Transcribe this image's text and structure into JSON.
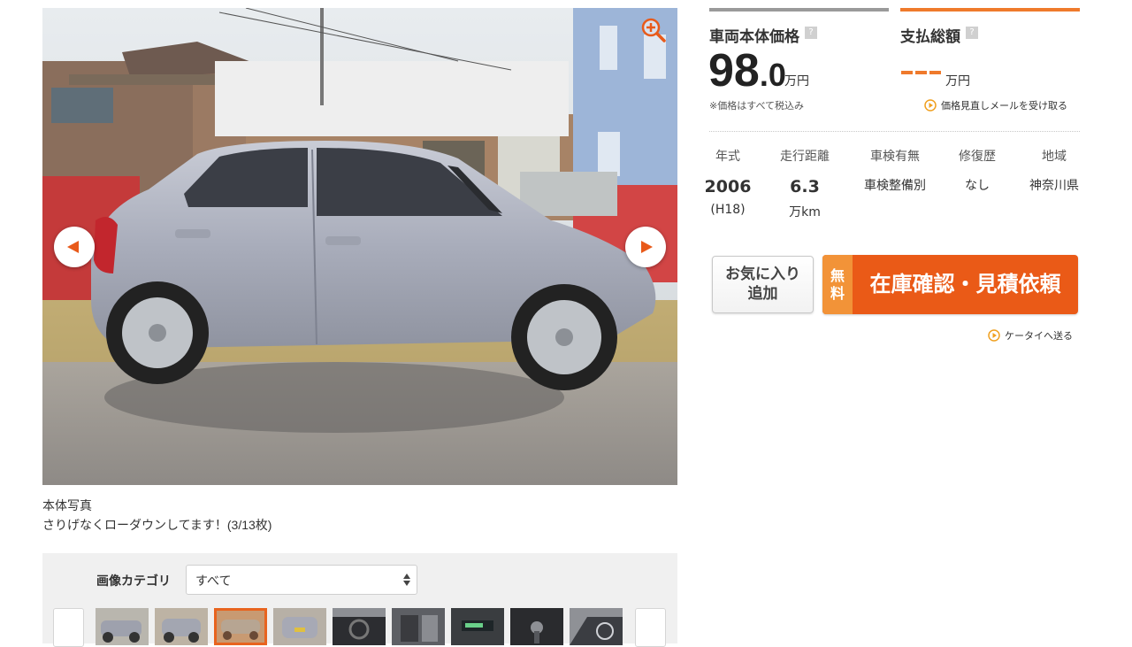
{
  "photo": {
    "caption_title": "本体写真",
    "caption_text": "さりげなくローダウンしてます！(3/13枚)"
  },
  "category": {
    "label": "画像カテゴリ",
    "selected": "すべて"
  },
  "thumbnails": {
    "count": 9,
    "active_index": 2
  },
  "price": {
    "vehicle_label": "車両本体価格",
    "vehicle_int": "98",
    "vehicle_dec": ".0",
    "unit": "万円",
    "tax_note": "※価格はすべて税込み",
    "total_label": "支払総額",
    "total_unit": "万円",
    "help": "?",
    "review_mail": "価格見直しメールを受け取る"
  },
  "specs": {
    "headers": [
      "年式",
      "走行距離",
      "車検有無",
      "修復歴",
      "地域"
    ],
    "year": "2006",
    "year_jp": "(H18)",
    "mileage": "6.3",
    "mileage_unit": "万km",
    "inspection": "車検整備別",
    "repair": "なし",
    "region": "神奈川県"
  },
  "actions": {
    "favorite_line1": "お気に入り",
    "favorite_line2": "追加",
    "free_line1": "無",
    "free_line2": "料",
    "inquiry": "在庫確認・見積依頼",
    "send_mobile": "ケータイへ送る"
  },
  "colors": {
    "accent": "#ea5a17",
    "accent_light": "#f29338",
    "bar_gray": "#9a9a9a"
  },
  "icons": [
    "zoom-in-icon",
    "prev-arrow-icon",
    "next-arrow-icon",
    "play-circle-icon",
    "select-updown-icon"
  ]
}
